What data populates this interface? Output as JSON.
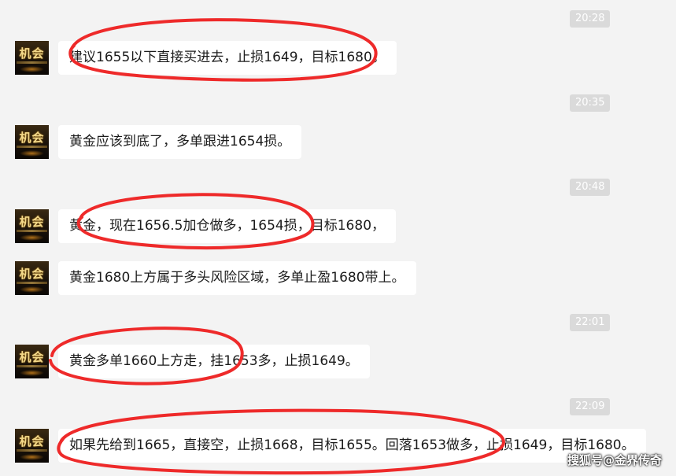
{
  "chat": {
    "time_1": "20:28",
    "time_2": "20:35",
    "time_3": "20:48",
    "time_4": "22:01",
    "time_5": "22:09",
    "avatar_text": "机会",
    "messages": [
      "建议1655以下直接买进去，止损1649，目标1680。",
      "黄金应该到底了，多单跟进1654损。",
      "黄金，现在1656.5加仓做多，1654损，目标1680，",
      "黄金1680上方属于多头风险区域，多单止盈1680带上。",
      "黄金多单1660上方走，挂1653多，止损1649。",
      "如果先给到1665，直接空，止损1668，目标1655。回落1653做多，止损1649，目标1680。"
    ]
  },
  "watermark": "搜狐号@金界传奇",
  "colors": {
    "background": "#f3f3f3",
    "bubble": "#ffffff",
    "timestamp": "#dadada",
    "annotation_oval": "#ee2a2a"
  }
}
